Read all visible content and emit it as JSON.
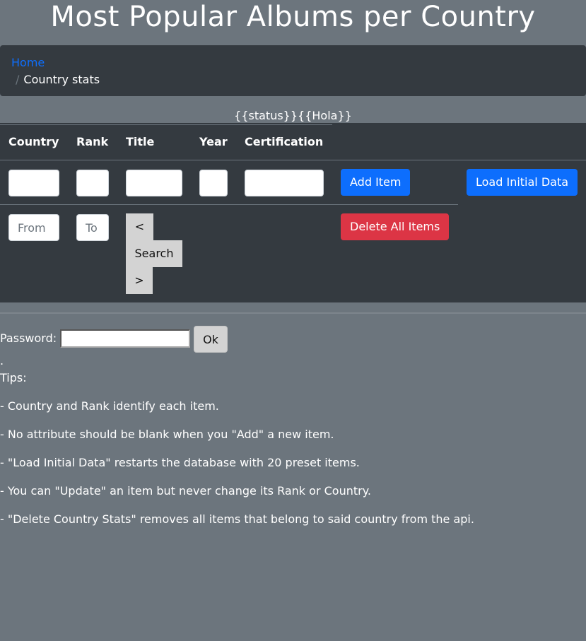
{
  "title": "Most Popular Albums per Country",
  "breadcrumb": {
    "home": "Home",
    "separator": "/",
    "current": "Country stats"
  },
  "status_template": "{{status}}{{Hola}}",
  "table": {
    "headers": [
      "Country",
      "Rank",
      "Title",
      "Year",
      "Certification"
    ],
    "add_label": "Add Item",
    "load_label": "Load Initial Data",
    "delete_label": "Delete All Items",
    "from_placeholder": "From",
    "to_placeholder": "To",
    "prev_label": "<",
    "search_label": "Search",
    "next_label": ">"
  },
  "password": {
    "label": "Password:",
    "ok_label": "Ok"
  },
  "dot": ".",
  "tips": {
    "title": "Tips:",
    "items": [
      "- Country and Rank identify each item.",
      "- No attribute should be blank when you \"Add\" a new item.",
      "- \"Load Initial Data\" restarts the database with 20 preset items.",
      "- You can \"Update\" an item but never change its Rank or Country.",
      "- \"Delete Country Stats\" removes all items that belong to said country from the api."
    ]
  },
  "colors": {
    "background": "#6c757d",
    "panel": "#343a40",
    "primary": "#0d6efd",
    "danger": "#dc3545"
  }
}
